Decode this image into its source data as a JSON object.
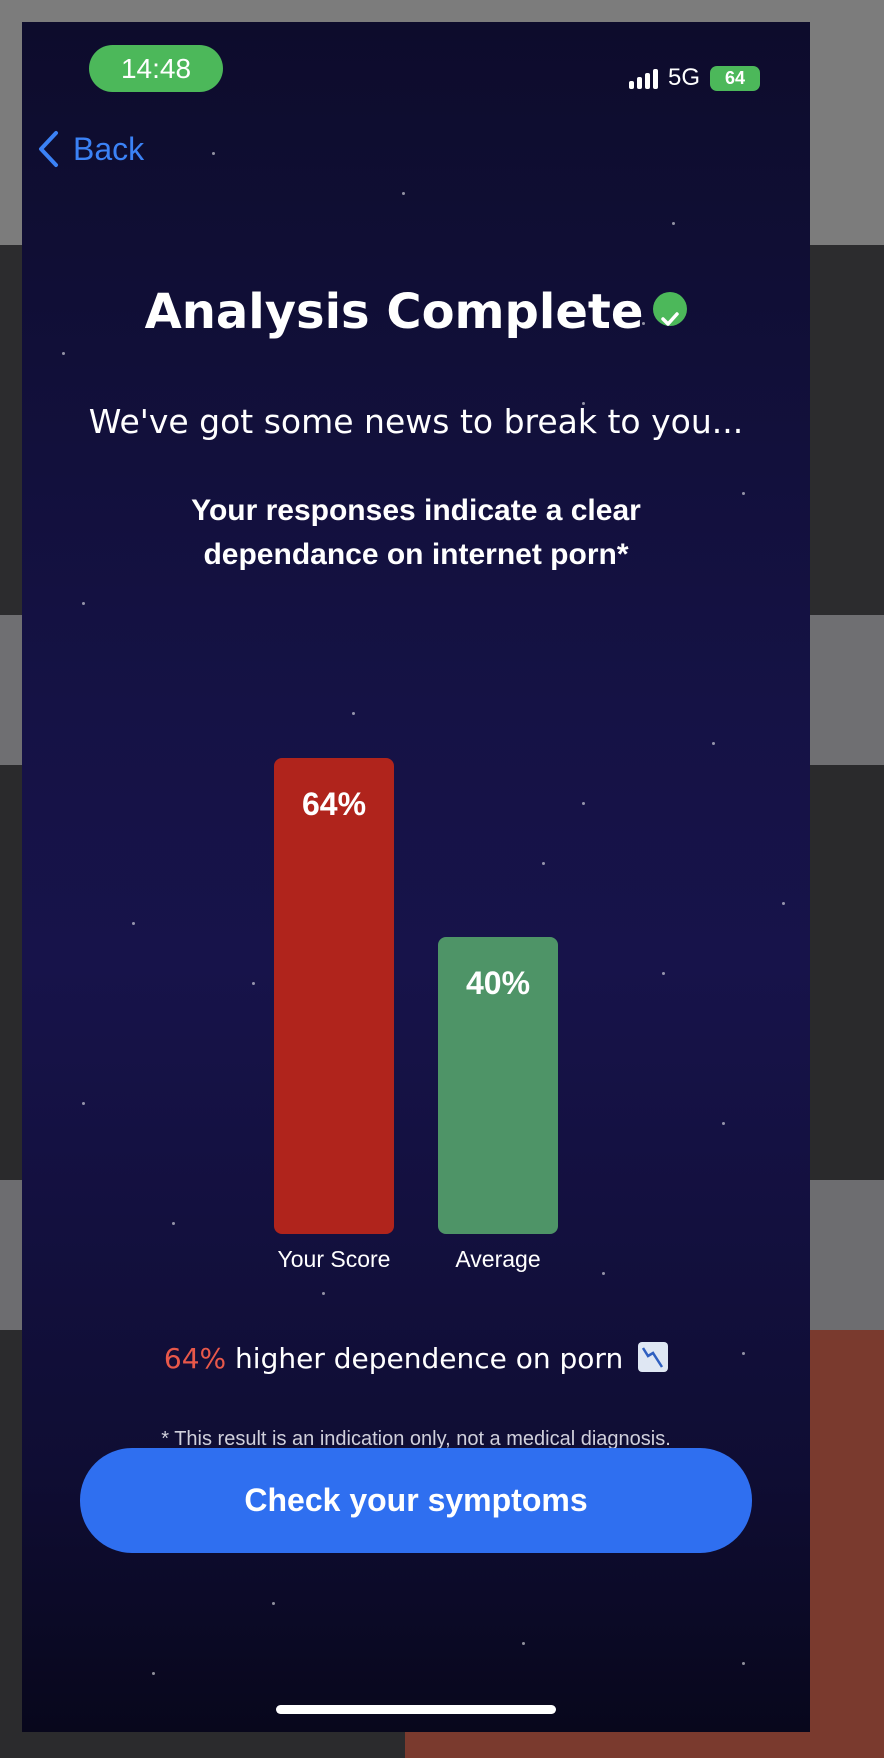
{
  "status_bar": {
    "time": "14:48",
    "network": "5G",
    "battery": "64"
  },
  "nav": {
    "back_label": "Back"
  },
  "header": {
    "title": "Analysis Complete",
    "subtitle": "We've got some news to break to you...",
    "message": "Your responses indicate a clear dependance on internet porn*"
  },
  "chart_data": {
    "type": "bar",
    "categories": [
      "Your Score",
      "Average"
    ],
    "values": [
      64,
      40
    ],
    "value_labels": [
      "64%",
      "40%"
    ],
    "colors": [
      "#b0241c",
      "#4e9467"
    ],
    "ylim": [
      0,
      100
    ]
  },
  "comparison": {
    "highlight": "64%",
    "text": " higher dependence on porn",
    "icon": "chart-down-icon",
    "highlight_color": "#e8584a"
  },
  "disclaimer": "* This result is an indication only, not a medical diagnosis.",
  "cta": {
    "label": "Check your symptoms",
    "color": "#2f6ff0"
  }
}
